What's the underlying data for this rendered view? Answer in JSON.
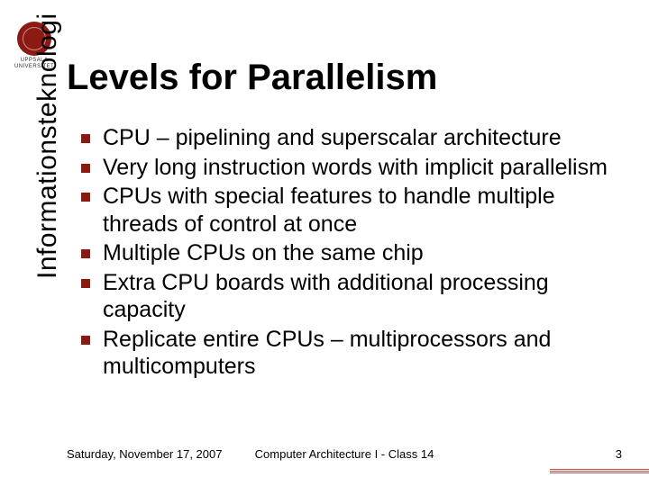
{
  "logo": {
    "line1": "UPPSALA",
    "line2": "UNIVERSITET"
  },
  "title": "Levels for Parallelism",
  "sidebar": "Informationsteknologi",
  "bullets": [
    "CPU – pipelining and superscalar architecture",
    "Very long instruction words with implicit parallelism",
    "CPUs with special features to handle multiple threads of control at once",
    "Multiple CPUs on the same chip",
    "Extra CPU boards with additional processing capacity",
    "Replicate entire CPUs – multiprocessors and multicomputers"
  ],
  "footer": {
    "date": "Saturday, November 17, 2007",
    "course": "Computer Architecture I - Class 14",
    "page": "3"
  }
}
